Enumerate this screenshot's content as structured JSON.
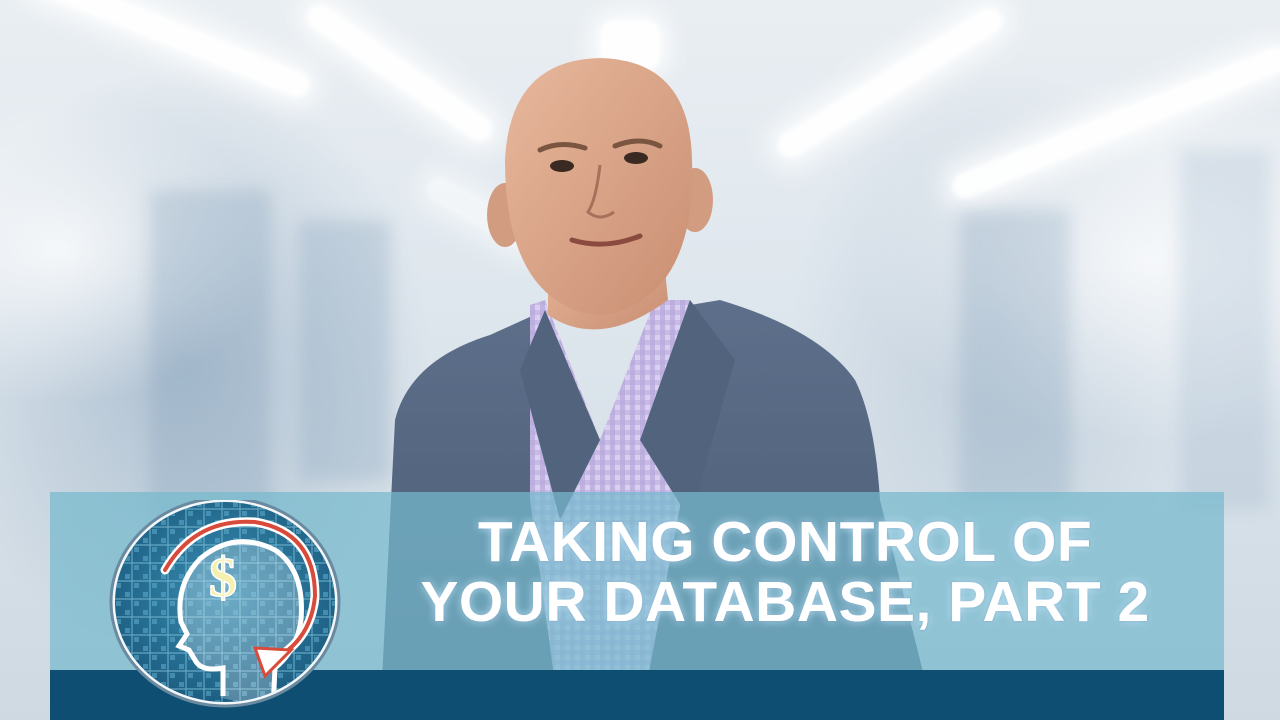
{
  "scene": {
    "description_icon": "presenter-video-frame"
  },
  "banner": {
    "title_line1": "TAKING CONTROL OF",
    "title_line2": "YOUR DATABASE, PART 2",
    "banner_color": "#76bacd",
    "footer_color": "#0e4e73",
    "title_color": "#ffffff"
  },
  "logo": {
    "icon": "head-dollar-logo-icon",
    "symbol": "$"
  }
}
